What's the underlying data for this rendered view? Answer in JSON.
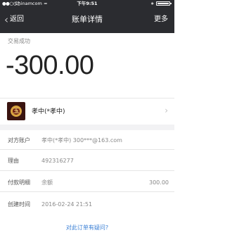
{
  "status_bar": {
    "signal": "●●○○○",
    "carrier": "Chinamcom",
    "wifi": "≈",
    "time": "下午9:51",
    "bluetooth": "∗"
  },
  "nav": {
    "back_label": "返回",
    "title": "账单详情",
    "more_label": "更多"
  },
  "transaction": {
    "status": "交易成功",
    "amount": "-300.00"
  },
  "contact": {
    "avatar_char": "玉",
    "name": "孝中(*孝中)"
  },
  "details": [
    {
      "label": "对方账户",
      "value": "孝中(*孝中) 300***@163.com"
    },
    {
      "label": "理由",
      "value": "492316277"
    },
    {
      "label": "付款明细",
      "value": "余额",
      "amount": "300.00"
    },
    {
      "label": "创建时间",
      "value": "2016-02-24 21:51"
    }
  ],
  "footer": {
    "question_link": "对此订单有疑问?"
  },
  "colors": {
    "nav_background": "#2b2c30",
    "link": "#3a7fd5",
    "separator": "#e6e6e6"
  }
}
